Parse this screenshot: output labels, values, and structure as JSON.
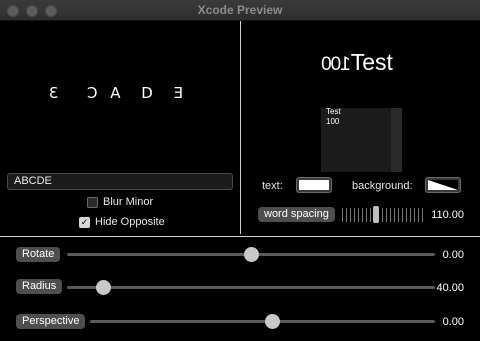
{
  "window": {
    "title": "Xcode Preview"
  },
  "left_pane": {
    "preview_letters": [
      "Ɛ",
      "C",
      "A",
      "D",
      "Ǝ"
    ],
    "text_field_value": "ABCDE",
    "blur_minor": {
      "label": "Blur Minor",
      "checked": false
    },
    "hide_opposite": {
      "label": "Hide Opposite",
      "checked": true,
      "mark": "✓"
    }
  },
  "right_pane": {
    "title_mirrored": "100",
    "title_text": "Test",
    "swatch_line1": "Test",
    "swatch_line2": "100",
    "text_label": "text:",
    "background_label": "background:",
    "word_spacing_label": "word spacing",
    "word_spacing_value": "110.00"
  },
  "sliders": [
    {
      "label": "Rotate",
      "value": "0.00",
      "fraction": 0.5
    },
    {
      "label": "Radius",
      "value": "40.00",
      "fraction": 0.1
    },
    {
      "label": "Perspective",
      "value": "0.00",
      "fraction": 0.53
    }
  ],
  "colors": {
    "background": "#000000",
    "control": "#4e4e4e",
    "knob": "#c8c8c8"
  }
}
